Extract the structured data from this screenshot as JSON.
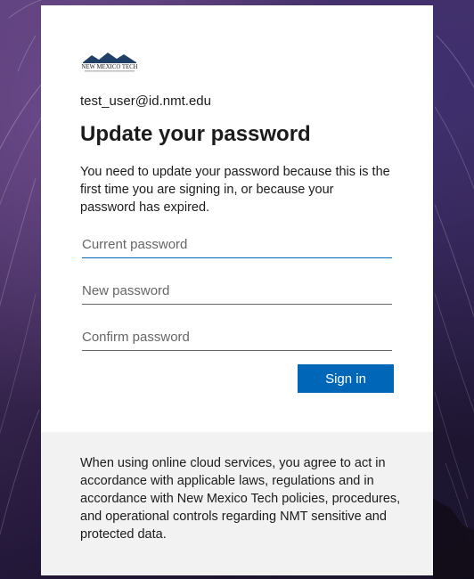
{
  "logo": {
    "name": "new-mexico-tech-logo",
    "text": "NEW MEXICO TECH",
    "tagline": "SCIENCE • ENGINEERING • RESEARCH UNIVERSITY"
  },
  "account": {
    "email": "test_user@id.nmt.edu"
  },
  "heading": {
    "title": "Update your password",
    "description": "You need to update your password because this is the first time you are signing in, or because your password has expired."
  },
  "form": {
    "current_password": {
      "placeholder": "Current password",
      "value": ""
    },
    "new_password": {
      "placeholder": "New password",
      "value": ""
    },
    "confirm_password": {
      "placeholder": "Confirm password",
      "value": ""
    },
    "submit_label": "Sign in"
  },
  "footer": {
    "text": "When using online cloud services, you agree to act in accordance with applicable laws, regulations and in accordance with New Mexico Tech policies, procedures, and operational controls regarding NMT sensitive and protected data."
  },
  "colors": {
    "accent": "#0067b8",
    "card_background": "#ffffff",
    "footer_background": "#f2f2f2",
    "text": "#1b1b1b"
  }
}
